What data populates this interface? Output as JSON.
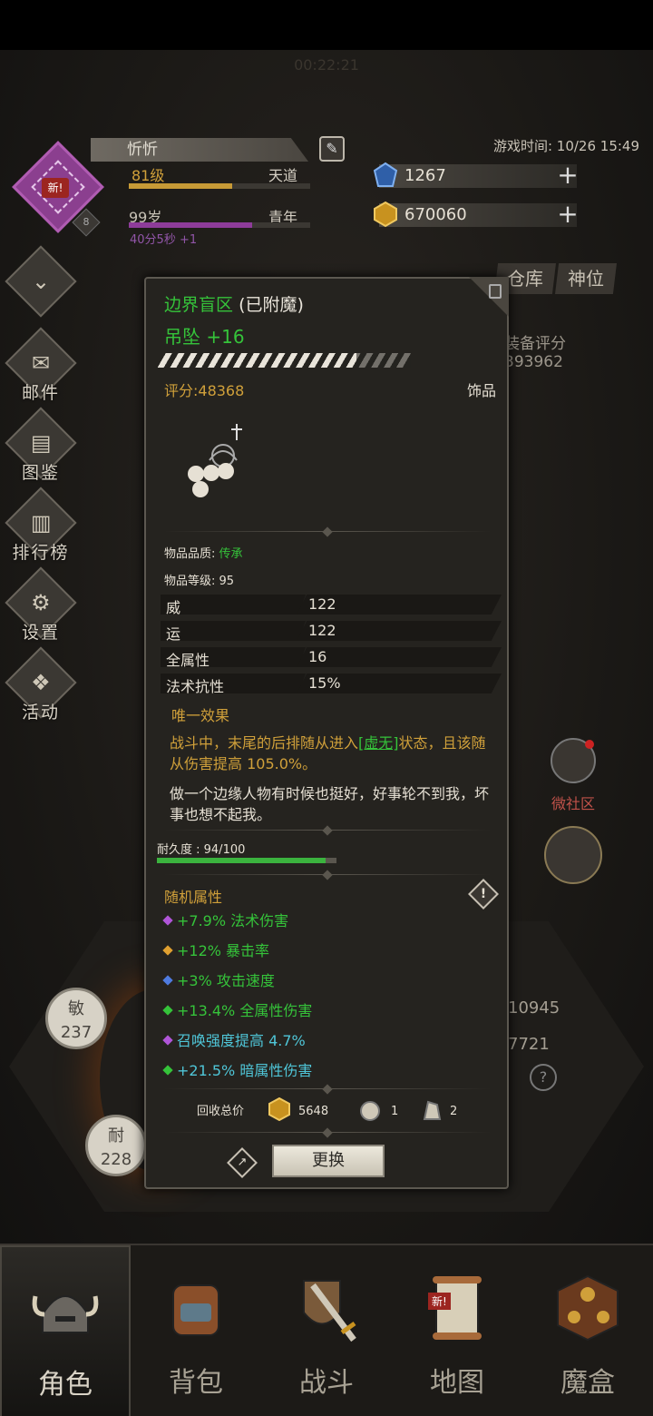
{
  "header": {
    "faded_clock": "00:22:21",
    "player_name": "忻忻",
    "level_text": "81级",
    "realm_text": "天道",
    "level_progress": 0.57,
    "age_text": "99岁",
    "age_stage": "青年",
    "age_progress": 0.68,
    "regen_text": "40分5秒 +1",
    "new_badge": "新!",
    "avatar_level": "8",
    "game_time": "游戏时间: 10/26 15:49",
    "currency_gem": "1267",
    "currency_gold": "670060"
  },
  "side_menu": [
    {
      "label": "",
      "icon": "chevron-down-icon"
    },
    {
      "label": "邮件",
      "icon": "mail-icon"
    },
    {
      "label": "图鉴",
      "icon": "book-icon"
    },
    {
      "label": "排行榜",
      "icon": "ranking-icon"
    },
    {
      "label": "设置",
      "icon": "gear-icon"
    },
    {
      "label": "活动",
      "icon": "gift-icon"
    }
  ],
  "background": {
    "tab_warehouse": "仓库",
    "tab_deity": "神位",
    "equip_score_label": "装备评分",
    "equip_score_value": "393962",
    "social_label": "微社区",
    "stat_agility_label": "敏",
    "stat_agility_value": "237",
    "stat_endurance_label": "耐",
    "stat_endurance_value": "228",
    "num_1": "10945",
    "num_2": "7721"
  },
  "tooltip": {
    "item_name": "边界盲区",
    "enchant_status": "(已附魔)",
    "item_type": "吊坠 +16",
    "score": "评分:48368",
    "category": "饰品",
    "quality_label": "物品品质: ",
    "quality_value": "传承",
    "item_level": "物品等级: 95",
    "attributes": [
      {
        "k": "威",
        "v": "122"
      },
      {
        "k": "运",
        "v": "122"
      },
      {
        "k": "全属性",
        "v": "16"
      },
      {
        "k": "法术抗性",
        "v": "15%"
      }
    ],
    "unique_title": "唯一效果",
    "unique_desc_1": "战斗中，末尾的后排随从进入",
    "unique_desc_link": "[虚无]",
    "unique_desc_2": "状态，且该随从伤害提高 105.0%。",
    "flavor_text": "做一个边缘人物有时候也挺好，好事轮不到我，坏事也想不起我。",
    "durability_text": "耐久度 : 94/100",
    "durability_fraction": 0.94,
    "random_title": "随机属性",
    "random_attrs": [
      {
        "text": "+7.9% 法术伤害",
        "color": "#35c33a",
        "dot": "#b055d8"
      },
      {
        "text": "+12% 暴击率",
        "color": "#35c33a",
        "dot": "#e0a030"
      },
      {
        "text": "+3% 攻击速度",
        "color": "#35c33a",
        "dot": "#4f7be0"
      },
      {
        "text": "+13.4% 全属性伤害",
        "color": "#35c33a",
        "dot": "#35c33a"
      },
      {
        "text": "召唤强度提高 4.7%",
        "color": "#4fc6d8",
        "dot": "#b055d8"
      },
      {
        "text": "+21.5% 暗属性伤害",
        "color": "#4fc6d8",
        "dot": "#35c33a"
      }
    ],
    "recycle_label": "回收总价",
    "recycle_gold": "5648",
    "recycle_mat1": "1",
    "recycle_mat2": "2",
    "replace_button": "更换"
  },
  "bottom_nav": [
    {
      "label": "角色",
      "icon": "helmet-icon",
      "active": true
    },
    {
      "label": "背包",
      "icon": "backpack-icon",
      "active": false
    },
    {
      "label": "战斗",
      "icon": "sword-shield-icon",
      "active": false
    },
    {
      "label": "地图",
      "icon": "map-scroll-icon",
      "active": false,
      "badge": "新!"
    },
    {
      "label": "魔盒",
      "icon": "magic-box-icon",
      "active": false
    }
  ],
  "colors": {
    "accent_gold": "#d0a03a",
    "accent_green": "#35c33a",
    "accent_cyan": "#4fc6d8",
    "purple": "#8e3c9a"
  }
}
